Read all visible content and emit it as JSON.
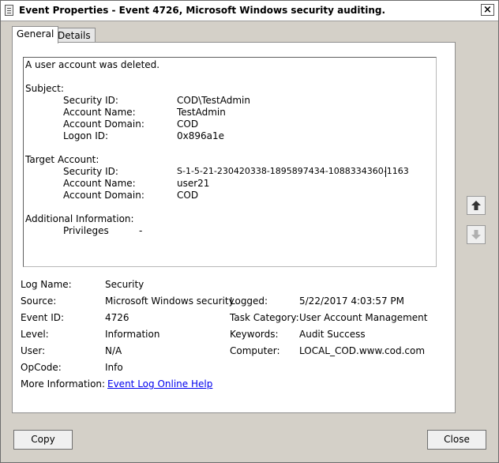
{
  "window": {
    "title": "Event Properties - Event 4726, Microsoft Windows security auditing."
  },
  "tabs": [
    {
      "label": "General"
    },
    {
      "label": "Details"
    }
  ],
  "description": {
    "summary": "A user account was deleted.",
    "subject_header": "Subject:",
    "subject": [
      {
        "label": "Security ID:",
        "value": "COD\\TestAdmin"
      },
      {
        "label": "Account Name:",
        "value": "TestAdmin"
      },
      {
        "label": "Account Domain:",
        "value": "COD"
      },
      {
        "label": "Logon ID:",
        "value": "0x896a1e"
      }
    ],
    "target_header": "Target Account:",
    "target": [
      {
        "label": "Security ID:",
        "value": "S-1-5-21-230420338-1895897434-1088334360-1163"
      },
      {
        "label": "Account Name:",
        "value": "user21"
      },
      {
        "label": "Account Domain:",
        "value": "COD"
      }
    ],
    "additional_header": "Additional Information:",
    "additional": [
      {
        "label": "Privileges",
        "value": "-"
      }
    ]
  },
  "details": {
    "log_name": {
      "label": "Log Name:",
      "value": "Security"
    },
    "source": {
      "label": "Source:",
      "value": "Microsoft Windows security"
    },
    "logged": {
      "label": "Logged:",
      "value": "5/22/2017 4:03:57 PM"
    },
    "event_id": {
      "label": "Event ID:",
      "value": "4726"
    },
    "task_category": {
      "label": "Task Category:",
      "value": "User Account Management"
    },
    "level": {
      "label": "Level:",
      "value": "Information"
    },
    "keywords": {
      "label": "Keywords:",
      "value": "Audit Success"
    },
    "user": {
      "label": "User:",
      "value": "N/A"
    },
    "computer": {
      "label": "Computer:",
      "value": "LOCAL_COD.www.cod.com"
    },
    "opcode": {
      "label": "OpCode:",
      "value": "Info"
    },
    "more_info": {
      "label": "More Information:",
      "link": "Event Log Online Help"
    }
  },
  "nav": {
    "up_icon": "arrow-up-icon",
    "down_icon": "arrow-down-icon"
  },
  "buttons": {
    "copy": "Copy",
    "close": "Close"
  },
  "icons": {
    "close": "×"
  }
}
